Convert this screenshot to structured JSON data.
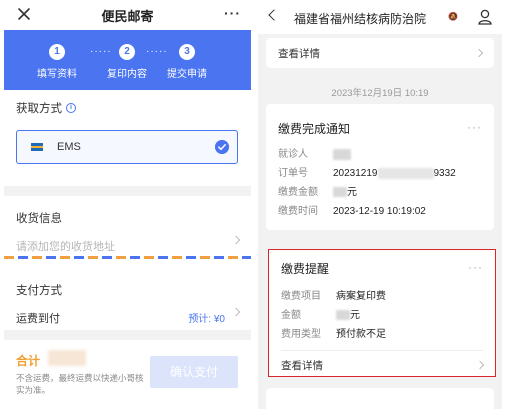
{
  "left": {
    "nav": {
      "title": "便民邮寄",
      "more": "···"
    },
    "steps": [
      {
        "num": "1",
        "label": "填写资料"
      },
      {
        "num": "2",
        "label": "复印内容"
      },
      {
        "num": "3",
        "label": "提交申请"
      }
    ],
    "step_dots": "·····",
    "pickup": {
      "title": "获取方式",
      "option": "EMS"
    },
    "address": {
      "title": "收货信息",
      "placeholder": "请添加您的收货地址"
    },
    "payment": {
      "title": "支付方式",
      "method": "运费到付",
      "estimate": "预计: ¥0"
    },
    "footer": {
      "total_label": "合计",
      "note": "不含运费，最终运费以快递小哥核实为准。",
      "confirm": "确认支付"
    }
  },
  "right": {
    "nav": {
      "title": "福建省福州结核病防治院",
      "bell": "🔕"
    },
    "top_card": {
      "link": "查看详情"
    },
    "timestamp": "2023年12月19日 10:19",
    "notice_card": {
      "title": "缴费完成通知",
      "rows": [
        {
          "key": "就诊人",
          "value": ""
        },
        {
          "key": "订单号",
          "value": "20231219",
          "suffix": "9332"
        },
        {
          "key": "缴费金额",
          "value": "",
          "suffix": "元"
        },
        {
          "key": "缴费时间",
          "value": "2023-12-19 10:19:02"
        }
      ]
    },
    "reminder_card": {
      "title": "缴费提醒",
      "rows": [
        {
          "key": "缴费项目",
          "value": "病案复印费"
        },
        {
          "key": "金额",
          "value": "",
          "suffix": "元"
        },
        {
          "key": "费用类型",
          "value": "预付款不足"
        }
      ],
      "link": "查看详情"
    },
    "colors": {
      "accent": "#4a74f0",
      "highlight": "#d9262a",
      "total": "#f0a030"
    }
  }
}
